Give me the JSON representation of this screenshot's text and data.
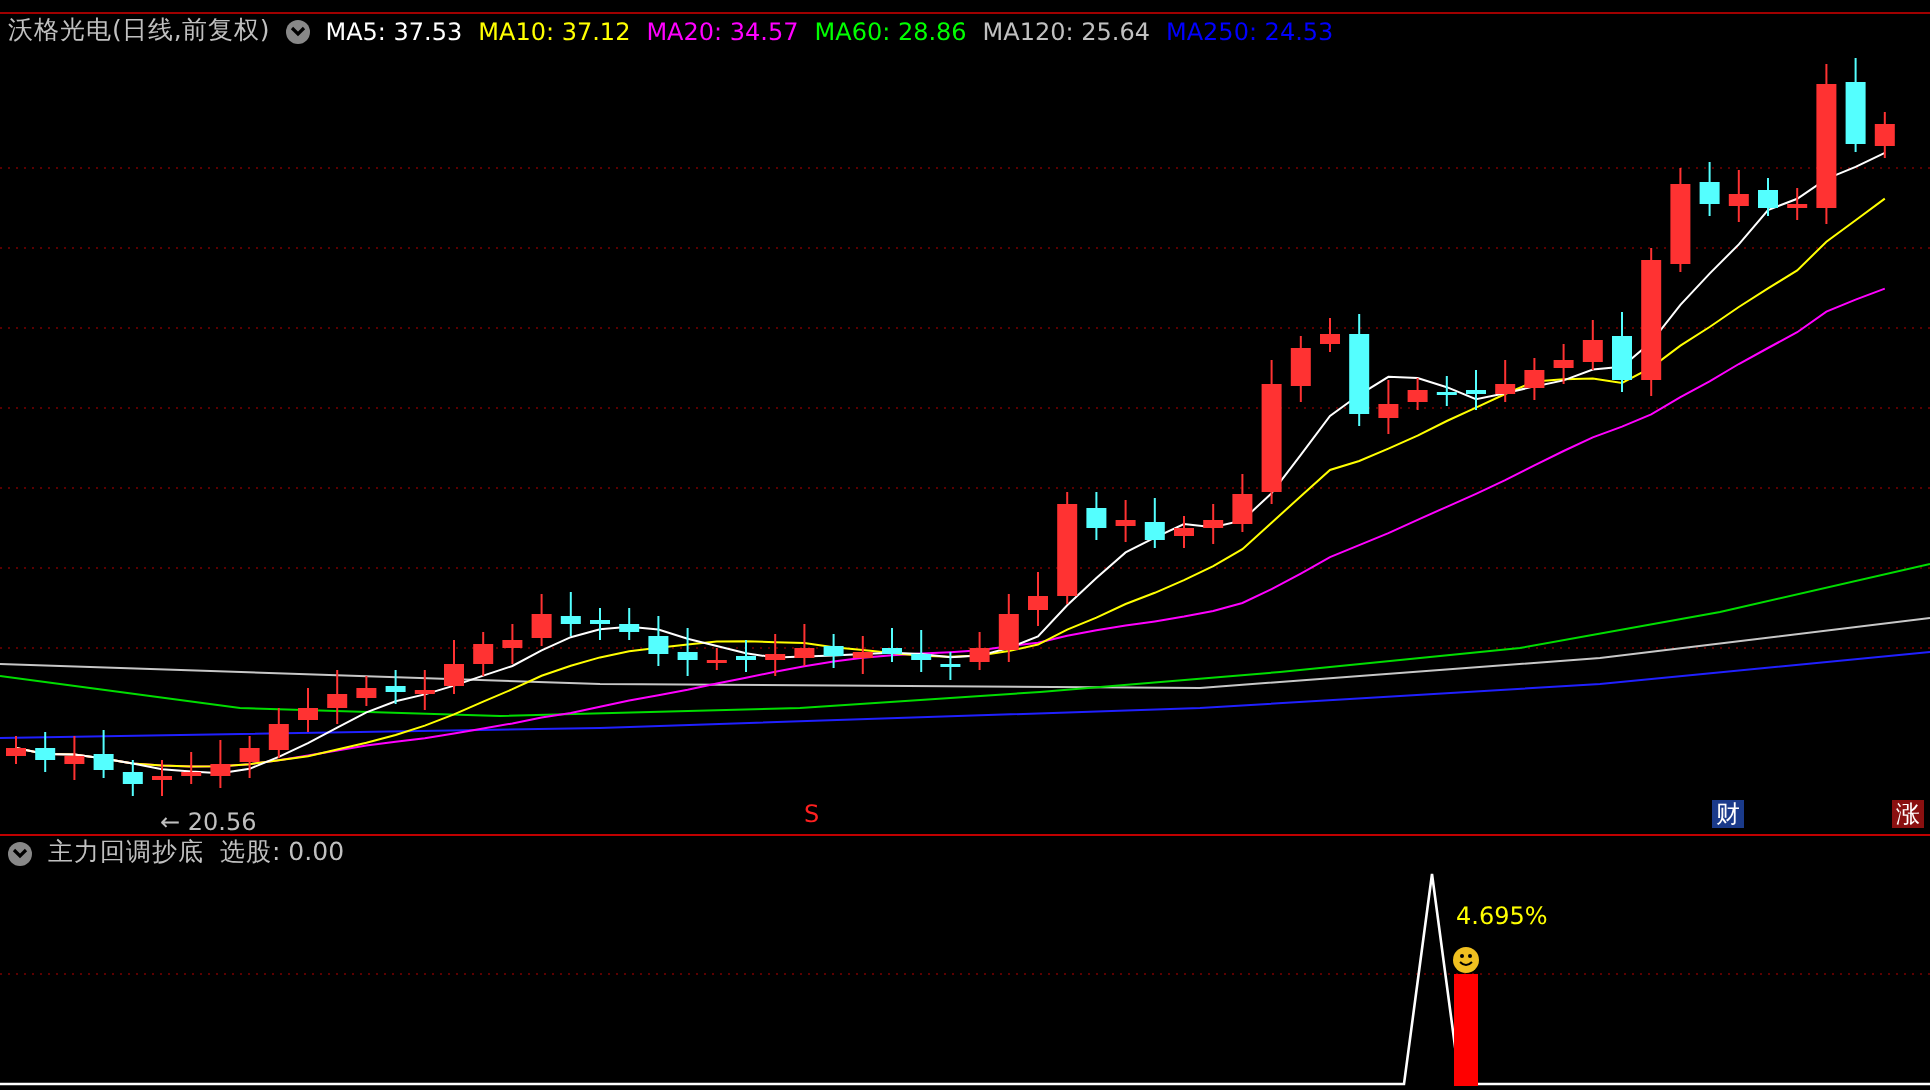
{
  "main_panel": {
    "title": "沃格光电(日线,前复权)",
    "ma_legend": [
      {
        "label": "MA5: 37.53",
        "color": "#ffffff"
      },
      {
        "label": "MA10: 37.12",
        "color": "#ffff00"
      },
      {
        "label": "MA20: 34.57",
        "color": "#ff00ff"
      },
      {
        "label": "MA60: 28.86",
        "color": "#00ff00"
      },
      {
        "label": "MA120: 25.64",
        "color": "#c0c0c0"
      },
      {
        "label": "MA250: 24.53",
        "color": "#0000ff"
      }
    ],
    "low_price_marker": "← 20.56",
    "signal_markers": [
      {
        "text": "S",
        "kind": "sell"
      },
      {
        "text": "财",
        "kind": "finance"
      },
      {
        "text": "涨",
        "kind": "limit"
      }
    ]
  },
  "indicator_panel": {
    "title": "主力回调抄底",
    "reading": "选股: 0.00",
    "value_label": "4.695%"
  }
}
